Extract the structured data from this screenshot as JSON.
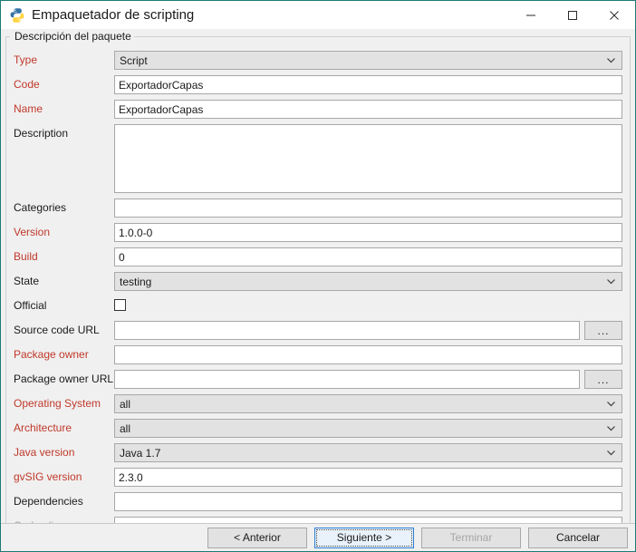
{
  "window": {
    "title": "Empaquetador de scripting",
    "icon": "python-logo-icon",
    "border_color": "#1c7b74",
    "controls": {
      "minimize": "minimize-icon",
      "maximize": "maximize-icon",
      "close": "close-icon"
    }
  },
  "groupbox": {
    "title": "Descripción del paquete"
  },
  "colors": {
    "required_label": "#c0392b",
    "normal_label": "#1a1a1a",
    "disabled_label": "#a0a0a0",
    "focus_accent": "#2a7fd4",
    "disabled_field_bg": "#e2e2e2"
  },
  "fields": [
    {
      "label": "Type",
      "required": true,
      "disabled_label": false,
      "control": "combo",
      "value": "Script",
      "placeholder": "",
      "enabled": false,
      "browse": false
    },
    {
      "label": "Code",
      "required": true,
      "disabled_label": false,
      "control": "text",
      "value": "ExportadorCapas",
      "placeholder": "",
      "enabled": true,
      "browse": false
    },
    {
      "label": "Name",
      "required": true,
      "disabled_label": false,
      "control": "text",
      "value": "ExportadorCapas",
      "placeholder": "",
      "enabled": true,
      "browse": false
    },
    {
      "label": "Description",
      "required": false,
      "disabled_label": false,
      "control": "textarea",
      "value": "",
      "placeholder": "",
      "enabled": true,
      "browse": false
    },
    {
      "label": "Categories",
      "required": false,
      "disabled_label": false,
      "control": "text",
      "value": "",
      "placeholder": "",
      "enabled": true,
      "browse": false
    },
    {
      "label": "Version",
      "required": true,
      "disabled_label": false,
      "control": "text",
      "value": "1.0.0-0",
      "placeholder": "",
      "enabled": true,
      "browse": false
    },
    {
      "label": "Build",
      "required": true,
      "disabled_label": false,
      "control": "text",
      "value": "0",
      "placeholder": "",
      "enabled": true,
      "browse": false
    },
    {
      "label": "State",
      "required": false,
      "disabled_label": false,
      "control": "combo",
      "value": "testing",
      "placeholder": "",
      "enabled": false,
      "browse": false
    },
    {
      "label": "Official",
      "required": false,
      "disabled_label": false,
      "control": "checkbox",
      "value": "",
      "checked": false,
      "placeholder": "",
      "enabled": true,
      "browse": false
    },
    {
      "label": "Source code URL",
      "required": false,
      "disabled_label": false,
      "control": "text",
      "value": "",
      "placeholder": "",
      "enabled": true,
      "browse": true,
      "browse_label": "..."
    },
    {
      "label": "Package owner",
      "required": true,
      "disabled_label": false,
      "control": "text",
      "value": "",
      "placeholder": "",
      "enabled": true,
      "browse": false
    },
    {
      "label": "Package owner URL",
      "required": false,
      "disabled_label": false,
      "control": "text",
      "value": "",
      "placeholder": "",
      "enabled": true,
      "browse": true,
      "browse_label": "..."
    },
    {
      "label": "Operating System",
      "required": true,
      "disabled_label": false,
      "control": "combo",
      "value": "all",
      "placeholder": "",
      "enabled": false,
      "browse": false
    },
    {
      "label": "Architecture",
      "required": true,
      "disabled_label": false,
      "control": "combo",
      "value": "all",
      "placeholder": "",
      "enabled": false,
      "browse": false
    },
    {
      "label": "Java version",
      "required": true,
      "disabled_label": false,
      "control": "combo",
      "value": "Java 1.7",
      "placeholder": "",
      "enabled": false,
      "browse": false
    },
    {
      "label": "gvSIG version",
      "required": true,
      "disabled_label": false,
      "control": "text",
      "value": "2.3.0",
      "placeholder": "",
      "enabled": true,
      "browse": false
    },
    {
      "label": "Dependencies",
      "required": false,
      "disabled_label": false,
      "control": "text",
      "value": "",
      "placeholder": "",
      "enabled": true,
      "browse": false
    },
    {
      "label": "Code alias",
      "required": false,
      "disabled_label": true,
      "control": "text",
      "value": "",
      "placeholder": "",
      "enabled": true,
      "browse": false
    }
  ],
  "buttons": [
    {
      "label": "< Anterior",
      "name": "previous-button",
      "state": "normal"
    },
    {
      "label": "Siguiente >",
      "name": "next-button",
      "state": "focused"
    },
    {
      "label": "Terminar",
      "name": "finish-button",
      "state": "disabled"
    },
    {
      "label": "Cancelar",
      "name": "cancel-button",
      "state": "normal"
    }
  ]
}
